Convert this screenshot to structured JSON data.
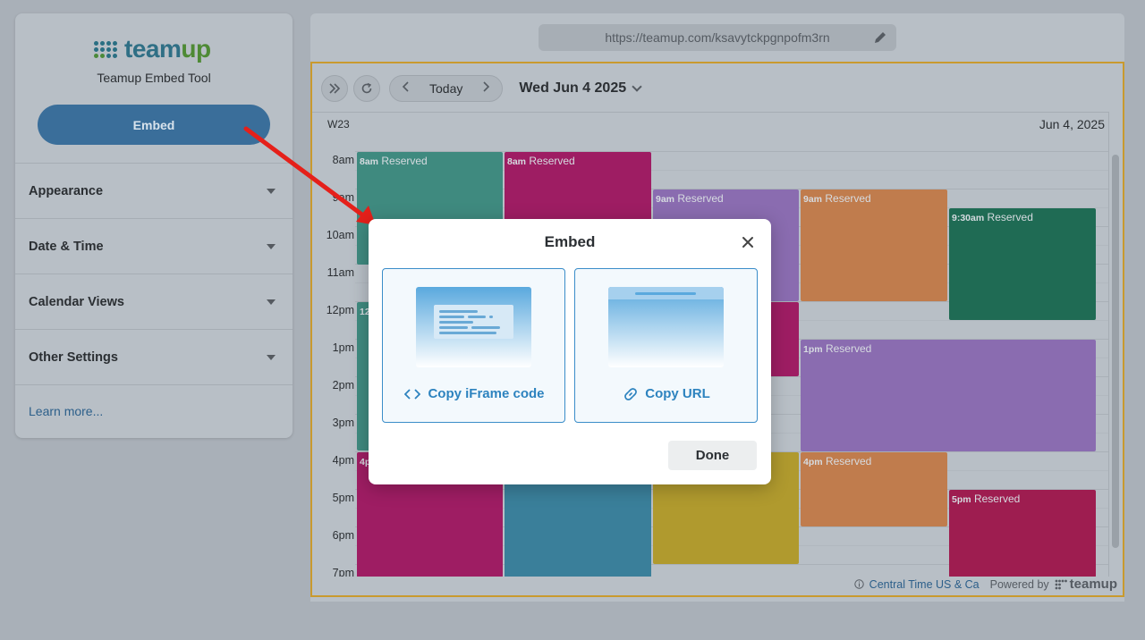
{
  "sidebar": {
    "logo_text_a": "team",
    "logo_text_b": "up",
    "tool_title": "Teamup Embed Tool",
    "embed_button": "Embed",
    "sections": [
      {
        "label": "Appearance"
      },
      {
        "label": "Date & Time"
      },
      {
        "label": "Calendar Views"
      },
      {
        "label": "Other Settings"
      }
    ],
    "learn_more": "Learn more..."
  },
  "url_bar": {
    "value": "https://teamup.com/ksavytckpgnpofm3rn"
  },
  "calendar": {
    "today_label": "Today",
    "date_title": "Wed Jun 4 2025",
    "week_label": "W23",
    "day_label": "Jun 4, 2025",
    "hours": [
      "8am",
      "9am",
      "10am",
      "11am",
      "12pm",
      "1pm",
      "2pm",
      "3pm",
      "4pm",
      "5pm",
      "6pm",
      "7pm"
    ],
    "events": [
      {
        "time": "8am",
        "title": "Reserved",
        "color": "#3f8a7f"
      },
      {
        "time": "8am",
        "title": "Reserved",
        "color": "#9e1d63"
      },
      {
        "time": "9am",
        "title": "Reserved",
        "color": "#8a6cb0"
      },
      {
        "time": "9am",
        "title": "Reserved",
        "color": "#c07c4d"
      },
      {
        "time": "9:30am",
        "title": "Reserved",
        "color": "#1f6b54"
      },
      {
        "time": "12",
        "title": "",
        "color": "#3f8a7f"
      },
      {
        "time": "",
        "title": "",
        "color": "#9e1d63"
      },
      {
        "time": "1pm",
        "title": "Reserved",
        "color": "#8a6cb0"
      },
      {
        "time": "4p",
        "title": "",
        "color": "#9e1d63"
      },
      {
        "time": "",
        "title": "",
        "color": "#3a7f9a"
      },
      {
        "time": "",
        "title": "",
        "color": "#b09a2e"
      },
      {
        "time": "4pm",
        "title": "Reserved",
        "color": "#c07c4d"
      },
      {
        "time": "5pm",
        "title": "Reserved",
        "color": "#9e1d50"
      }
    ],
    "timezone": "Central Time US & Ca",
    "powered_by": "Powered by",
    "footer_logo": "teamup"
  },
  "modal": {
    "title": "Embed",
    "option_iframe": "Copy iFrame code",
    "option_url": "Copy URL",
    "done": "Done"
  }
}
